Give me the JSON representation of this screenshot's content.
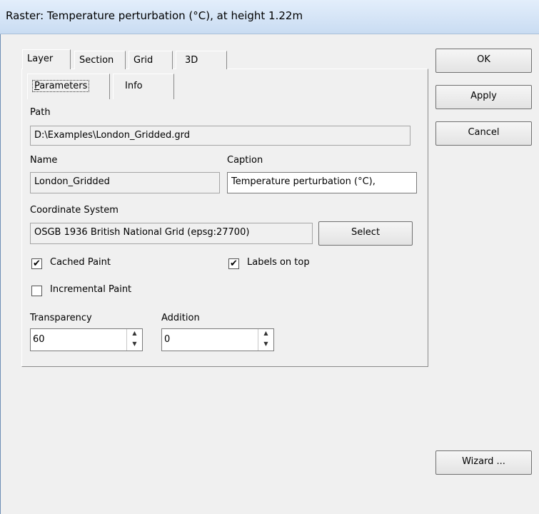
{
  "window": {
    "title": "Raster: Temperature perturbation (°C), at height 1.22m"
  },
  "tabs": [
    {
      "label": "Layer"
    },
    {
      "label": "Section"
    },
    {
      "label": "Grid"
    },
    {
      "label": "3D"
    }
  ],
  "subtabs": [
    {
      "label": "Parameters"
    },
    {
      "label": "Info"
    }
  ],
  "form": {
    "path_label": "Path",
    "path_value": "D:\\Examples\\London_Gridded.grd",
    "name_label": "Name",
    "name_value": "London_Gridded",
    "caption_label": "Caption",
    "caption_value": "Temperature perturbation (°C),",
    "coord_label": "Coordinate System",
    "coord_value": "OSGB 1936 British National Grid (epsg:27700)",
    "select_label": "Select",
    "cached_paint": {
      "label": "Cached Paint",
      "checked": true
    },
    "labels_on_top": {
      "label": "Labels on top",
      "checked": true
    },
    "incremental_paint": {
      "label": "Incremental Paint",
      "checked": false
    },
    "transparency_label": "Transparency",
    "transparency_value": "60",
    "addition_label": "Addition",
    "addition_value": "0"
  },
  "buttons": {
    "ok": "OK",
    "apply": "Apply",
    "cancel": "Cancel",
    "wizard": "Wizard ..."
  }
}
